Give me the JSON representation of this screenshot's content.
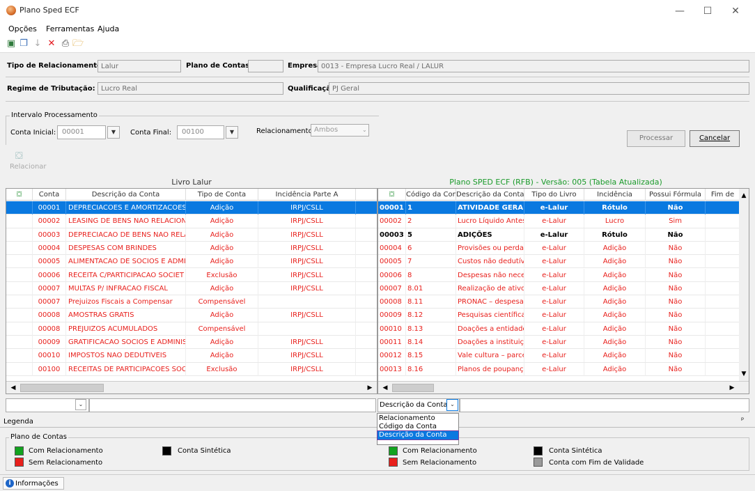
{
  "window": {
    "title": "Plano Sped ECF",
    "minimize": "—",
    "maximize": "☐",
    "close": "✕"
  },
  "menu": [
    "Opções",
    "Ferramentas",
    "Ajuda"
  ],
  "toolbar_icons": [
    "edit-icon",
    "copy-icon",
    "download-icon",
    "delete-icon",
    "print-icon",
    "folder-icon"
  ],
  "header": {
    "tipo_rel_label": "Tipo de Relacionamento:",
    "tipo_rel_value": "Lalur",
    "plano_label": "Plano de Contas:",
    "plano_value": "",
    "empresa_label": "Empresa:",
    "empresa_value": "0013 - Empresa Lucro Real / LALUR",
    "regime_label": "Regime de Tributação:",
    "regime_value": "Lucro Real",
    "qualificacao_label": "Qualificação:",
    "qualificacao_value": "PJ Geral"
  },
  "intervalo": {
    "group_title": "Intervalo Processamento",
    "conta_inicial_label": "Conta Inicial:",
    "conta_inicial": "00001",
    "conta_final_label": "Conta Final:",
    "conta_final": "00100",
    "relacionamento_label": "Relacionamento:",
    "relacionamento": "Ambos"
  },
  "buttons": {
    "processar": "Processar",
    "cancelar": "Cancelar",
    "relacionar": "Relacionar"
  },
  "left_grid": {
    "title": "Livro Lalur",
    "columns": [
      "Conta",
      "Descrição da Conta",
      "Tipo de Conta",
      "Incidência Parte A"
    ],
    "rows": [
      {
        "conta": "00001",
        "desc": "DEPRECIACOES E AMORTIZACOES :",
        "tipo": "Adição",
        "inc": "IRPJ/CSLL",
        "selected": true
      },
      {
        "conta": "00002",
        "desc": "LEASING DE BENS NAO RELACIONAI",
        "tipo": "Adição",
        "inc": "IRPJ/CSLL"
      },
      {
        "conta": "00003",
        "desc": "DEPRECIACAO DE BENS NAO RELAC",
        "tipo": "Adição",
        "inc": "IRPJ/CSLL"
      },
      {
        "conta": "00004",
        "desc": "DESPESAS COM BRINDES",
        "tipo": "Adição",
        "inc": "IRPJ/CSLL"
      },
      {
        "conta": "00005",
        "desc": "ALIMENTACAO DE SOCIOS E ADMIN",
        "tipo": "Adição",
        "inc": "IRPJ/CSLL"
      },
      {
        "conta": "00006",
        "desc": "RECEITA C/PARTICIPACAO SOCIET",
        "tipo": "Exclusão",
        "inc": "IRPJ/CSLL"
      },
      {
        "conta": "00007",
        "desc": "MULTAS P/ INFRACAO FISCAL",
        "tipo": "Adição",
        "inc": "IRPJ/CSLL"
      },
      {
        "conta": "00007",
        "desc": "Prejuizos Fiscais a Compensar",
        "tipo": "Compensável",
        "inc": ""
      },
      {
        "conta": "00008",
        "desc": "AMOSTRAS GRATIS",
        "tipo": "Adição",
        "inc": "IRPJ/CSLL"
      },
      {
        "conta": "00008",
        "desc": "PREJUIZOS ACUMULADOS",
        "tipo": "Compensável",
        "inc": ""
      },
      {
        "conta": "00009",
        "desc": "GRATIFICACAO SOCIOS E ADMINIS",
        "tipo": "Adição",
        "inc": "IRPJ/CSLL"
      },
      {
        "conta": "00010",
        "desc": "IMPOSTOS NAO DEDUTIVEIS",
        "tipo": "Adição",
        "inc": "IRPJ/CSLL"
      },
      {
        "conta": "00100",
        "desc": "RECEITAS DE PARTICIPACOES SOC",
        "tipo": "Exclusão",
        "inc": "IRPJ/CSLL"
      }
    ]
  },
  "right_grid": {
    "title": "Plano SPED ECF (RFB) - Versão: 005 (Tabela Atualizada)",
    "columns": [
      "Código da Conta",
      "Descrição da Conta",
      "Tipo do Livro",
      "Incidência",
      "Possui Fórmula",
      "Fim de"
    ],
    "rows": [
      {
        "id": "00001",
        "cod": "1",
        "desc": "ATIVIDADE GERA",
        "livro": "e-Lalur",
        "inc": "Rótulo",
        "form": "Não",
        "style": "selected"
      },
      {
        "id": "00002",
        "cod": "2",
        "desc": "Lucro Líquido Antes",
        "livro": "e-Lalur",
        "inc": "Lucro",
        "form": "Sim",
        "style": "red"
      },
      {
        "id": "00003",
        "cod": "5",
        "desc": "ADIÇÕES",
        "livro": "e-Lalur",
        "inc": "Rótulo",
        "form": "Não",
        "style": "bold"
      },
      {
        "id": "00004",
        "cod": "6",
        "desc": "Provisões ou perdas",
        "livro": "e-Lalur",
        "inc": "Adição",
        "form": "Não",
        "style": "red"
      },
      {
        "id": "00005",
        "cod": "7",
        "desc": "Custos não dedutíve",
        "livro": "e-Lalur",
        "inc": "Adição",
        "form": "Não",
        "style": "red"
      },
      {
        "id": "00006",
        "cod": "8",
        "desc": "Despesas não neces",
        "livro": "e-Lalur",
        "inc": "Adição",
        "form": "Não",
        "style": "red"
      },
      {
        "id": "00007",
        "cod": "8.01",
        "desc": "Realização de ativos",
        "livro": "e-Lalur",
        "inc": "Adição",
        "form": "Não",
        "style": "red"
      },
      {
        "id": "00008",
        "cod": "8.11",
        "desc": "PRONAC – despesa",
        "livro": "e-Lalur",
        "inc": "Adição",
        "form": "Não",
        "style": "red"
      },
      {
        "id": "00009",
        "cod": "8.12",
        "desc": "Pesquisas científicas",
        "livro": "e-Lalur",
        "inc": "Adição",
        "form": "Não",
        "style": "red"
      },
      {
        "id": "00010",
        "cod": "8.13",
        "desc": "Doações a entidade",
        "livro": "e-Lalur",
        "inc": "Adição",
        "form": "Não",
        "style": "red"
      },
      {
        "id": "00011",
        "cod": "8.14",
        "desc": "Doações a instituiçõ",
        "livro": "e-Lalur",
        "inc": "Adição",
        "form": "Não",
        "style": "red"
      },
      {
        "id": "00012",
        "cod": "8.15",
        "desc": "Vale cultura – parce",
        "livro": "e-Lalur",
        "inc": "Adição",
        "form": "Não",
        "style": "red"
      },
      {
        "id": "00013",
        "cod": "8.16",
        "desc": "Planos de poupança",
        "livro": "e-Lalur",
        "inc": "Adição",
        "form": "Não",
        "style": "red"
      }
    ]
  },
  "search": {
    "right_combo": "Descrição da Conta",
    "options": [
      "Relacionamento",
      "Código da Conta",
      "Descrição da Conta"
    ]
  },
  "legend": {
    "title": "Legenda",
    "pin": "ᵖ",
    "group": "Plano de Contas",
    "com_rel": "Com Relacionamento",
    "sem_rel": "Sem Relacionamento",
    "sintetica": "Conta Sintética",
    "fim_validade": "Conta com Fim de Validade",
    "colors": {
      "green": "#13a31f",
      "red": "#e8201c",
      "black": "#000000",
      "gray": "#9a9a9a"
    }
  },
  "statusbar": {
    "info": "Informações"
  }
}
